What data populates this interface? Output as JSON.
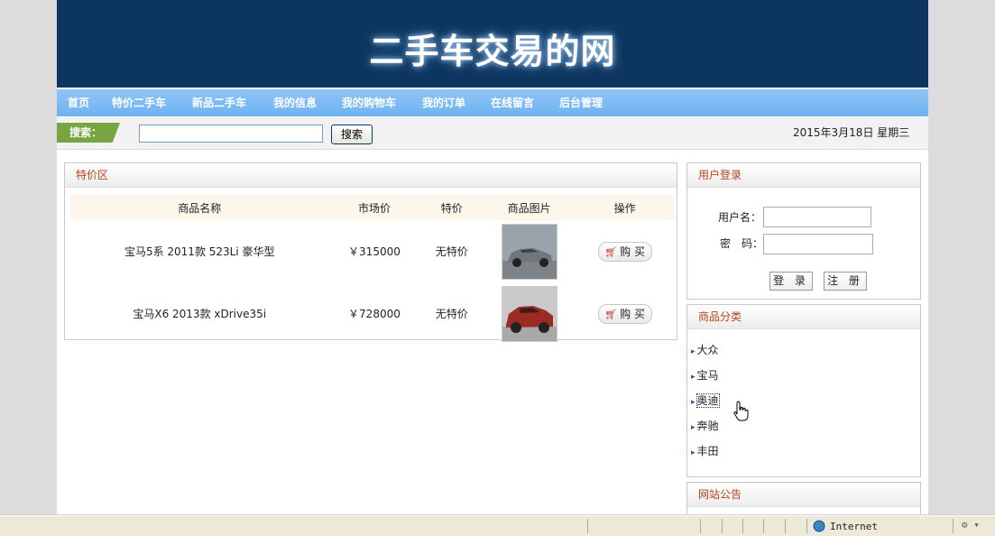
{
  "site": {
    "title": "二手车交易的网"
  },
  "nav": [
    "首页",
    "特价二手车",
    "新品二手车",
    "我的信息",
    "我的购物车",
    "我的订单",
    "在线留言",
    "后台管理"
  ],
  "search": {
    "label": "搜索：",
    "value": "",
    "button": "搜索"
  },
  "date": "2015年3月18日 星期三",
  "special": {
    "title": "特价区",
    "columns": [
      "商品名称",
      "市场价",
      "特价",
      "商品图片",
      "操作"
    ],
    "rows": [
      {
        "name": "宝马5系 2011款 523Li 豪华型",
        "price": "￥315000",
        "special": "无特价",
        "image": "grey-sedan",
        "action": "购 买"
      },
      {
        "name": "宝马X6 2013款 xDrive35i",
        "price": "￥728000",
        "special": "无特价",
        "image": "red-suv",
        "action": "购 买"
      }
    ]
  },
  "login": {
    "title": "用户登录",
    "username_label": "用户名：",
    "password_label": "密　码：",
    "login_btn": "登 录",
    "register_btn": "注 册"
  },
  "categories": {
    "title": "商品分类",
    "items": [
      "大众",
      "宝马",
      "奥迪",
      "奔驰",
      "丰田"
    ]
  },
  "notice": {
    "title": "网站公告"
  },
  "status": {
    "zone": "Internet"
  },
  "colors": {
    "header": "#0c365f",
    "nav": "#7cbaf3",
    "accent": "#b4451c",
    "search_tag": "#76a541"
  }
}
